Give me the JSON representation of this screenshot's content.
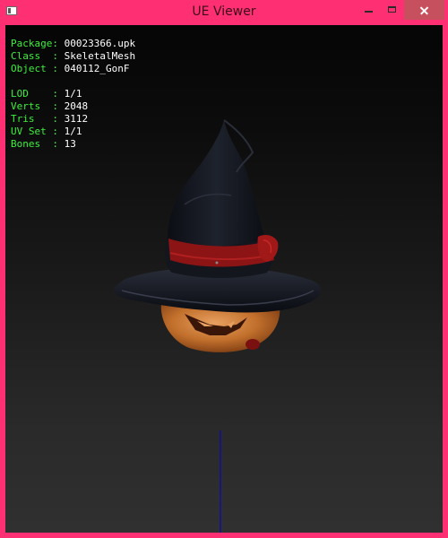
{
  "window": {
    "title": "UE Viewer"
  },
  "info": {
    "rows1": [
      {
        "label": "Package:",
        "value": "00023366.upk"
      },
      {
        "label": "Class  :",
        "value": "SkeletalMesh"
      },
      {
        "label": "Object :",
        "value": "040112_GonF"
      }
    ],
    "rows2": [
      {
        "label": "LOD    :",
        "value": "1/1"
      },
      {
        "label": "Verts  :",
        "value": "2048"
      },
      {
        "label": "Tris   :",
        "value": "3112"
      },
      {
        "label": "UV Set :",
        "value": "1/1"
      },
      {
        "label": "Bones  :",
        "value": "13"
      }
    ]
  },
  "colors": {
    "frame": "#ff2f74",
    "label": "#3cf03c",
    "value": "#ffffff",
    "axis": "#1010a0"
  },
  "icons": {
    "app": "app-icon",
    "minimize": "minimize-icon",
    "maximize": "maximize-icon",
    "close": "close-icon"
  }
}
